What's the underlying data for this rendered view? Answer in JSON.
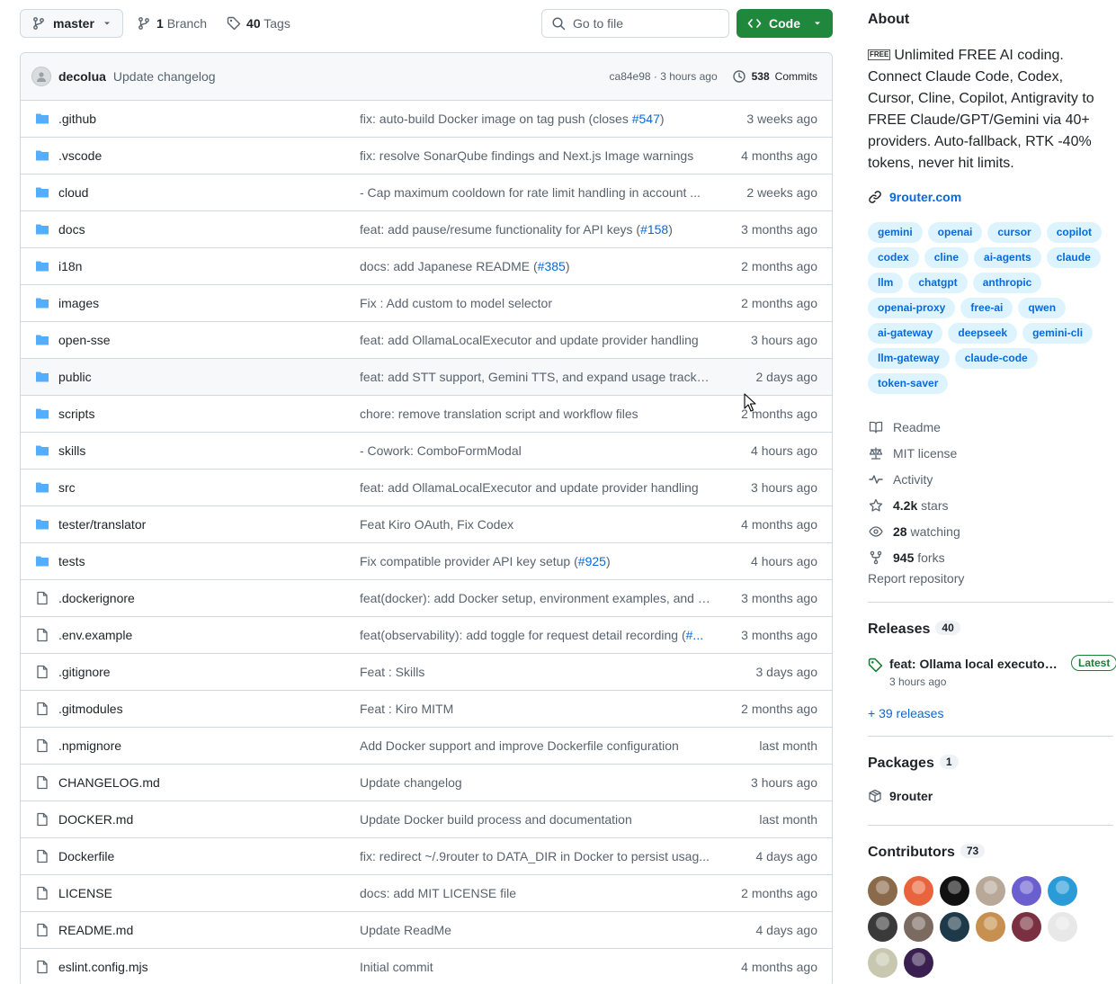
{
  "toolbar": {
    "branch_name": "master",
    "branch_count": "1",
    "branch_label": "Branch",
    "tag_count": "40",
    "tag_label": "Tags",
    "goto_placeholder": "Go to file",
    "code_label": "Code"
  },
  "latest_commit": {
    "author": "decolua",
    "message": "Update changelog",
    "meta": "ca84e98 · 3 hours ago",
    "count": "538",
    "count_label": "Commits"
  },
  "files": [
    {
      "type": "dir",
      "name": ".github",
      "message": "fix: auto-build Docker image on tag push (closes ",
      "issue": "#547",
      "tail": ")",
      "age": "3 weeks ago"
    },
    {
      "type": "dir",
      "name": ".vscode",
      "message": "fix: resolve SonarQube findings and Next.js Image warnings",
      "issue": "",
      "tail": "",
      "age": "4 months ago"
    },
    {
      "type": "dir",
      "name": "cloud",
      "message": "- Cap maximum cooldown for rate limit handling in account ...",
      "issue": "",
      "tail": "",
      "age": "2 weeks ago"
    },
    {
      "type": "dir",
      "name": "docs",
      "message": "feat: add pause/resume functionality for API keys (",
      "issue": "#158",
      "tail": ")",
      "age": "3 months ago"
    },
    {
      "type": "dir",
      "name": "i18n",
      "message": "docs: add Japanese README (",
      "issue": "#385",
      "tail": ")",
      "age": "2 months ago"
    },
    {
      "type": "dir",
      "name": "images",
      "message": "Fix : Add custom to model selector",
      "issue": "",
      "tail": "",
      "age": "2 months ago"
    },
    {
      "type": "dir",
      "name": "open-sse",
      "message": "feat: add OllamaLocalExecutor and update provider handling",
      "issue": "",
      "tail": "",
      "age": "3 hours ago"
    },
    {
      "type": "dir",
      "name": "public",
      "message": "feat: add STT support, Gemini TTS, and expand usage tracking",
      "issue": "",
      "tail": "",
      "age": "2 days ago"
    },
    {
      "type": "dir",
      "name": "scripts",
      "message": "chore: remove translation script and workflow files",
      "issue": "",
      "tail": "",
      "age": "2 months ago"
    },
    {
      "type": "dir",
      "name": "skills",
      "message": "- Cowork: ComboFormModal",
      "issue": "",
      "tail": "",
      "age": "4 hours ago"
    },
    {
      "type": "dir",
      "name": "src",
      "message": "feat: add OllamaLocalExecutor and update provider handling",
      "issue": "",
      "tail": "",
      "age": "3 hours ago"
    },
    {
      "type": "dir",
      "name": "tester/translator",
      "message": "Feat Kiro OAuth, Fix Codex",
      "issue": "",
      "tail": "",
      "age": "4 months ago"
    },
    {
      "type": "dir",
      "name": "tests",
      "message": "Fix compatible provider API key setup (",
      "issue": "#925",
      "tail": ")",
      "age": "4 hours ago"
    },
    {
      "type": "file",
      "name": ".dockerignore",
      "message": "feat(docker): add Docker setup, environment examples, and a...",
      "issue": "",
      "tail": "",
      "age": "3 months ago"
    },
    {
      "type": "file",
      "name": ".env.example",
      "message": "feat(observability): add toggle for request detail recording (",
      "issue": "#...",
      "tail": "",
      "age": "3 months ago"
    },
    {
      "type": "file",
      "name": ".gitignore",
      "message": "Feat : Skills",
      "issue": "",
      "tail": "",
      "age": "3 days ago"
    },
    {
      "type": "file",
      "name": ".gitmodules",
      "message": "Feat : Kiro MITM",
      "issue": "",
      "tail": "",
      "age": "2 months ago"
    },
    {
      "type": "file",
      "name": ".npmignore",
      "message": "Add Docker support and improve Dockerfile configuration",
      "issue": "",
      "tail": "",
      "age": "last month"
    },
    {
      "type": "file",
      "name": "CHANGELOG.md",
      "message": "Update changelog",
      "issue": "",
      "tail": "",
      "age": "3 hours ago"
    },
    {
      "type": "file",
      "name": "DOCKER.md",
      "message": "Update Docker build process and documentation",
      "issue": "",
      "tail": "",
      "age": "last month"
    },
    {
      "type": "file",
      "name": "Dockerfile",
      "message": "fix: redirect ~/.9router to DATA_DIR in Docker to persist usag...",
      "issue": "",
      "tail": "",
      "age": "4 days ago"
    },
    {
      "type": "file",
      "name": "LICENSE",
      "message": "docs: add MIT LICENSE file",
      "issue": "",
      "tail": "",
      "age": "2 months ago"
    },
    {
      "type": "file",
      "name": "README.md",
      "message": "Update ReadMe",
      "issue": "",
      "tail": "",
      "age": "4 days ago"
    },
    {
      "type": "file",
      "name": "eslint.config.mjs",
      "message": "Initial commit",
      "issue": "",
      "tail": "",
      "age": "4 months ago"
    }
  ],
  "about": {
    "title": "About",
    "badge": "FREE",
    "description": "Unlimited FREE AI coding. Connect Claude Code, Codex, Cursor, Cline, Copilot, Antigravity to FREE Claude/GPT/Gemini via 40+ providers. Auto-fallback, RTK -40% tokens, never hit limits.",
    "homepage": "9router.com",
    "topics": [
      "gemini",
      "openai",
      "cursor",
      "copilot",
      "codex",
      "cline",
      "ai-agents",
      "claude",
      "llm",
      "chatgpt",
      "anthropic",
      "openai-proxy",
      "free-ai",
      "qwen",
      "ai-gateway",
      "deepseek",
      "gemini-cli",
      "llm-gateway",
      "claude-code",
      "token-saver"
    ],
    "readme": "Readme",
    "license": "MIT license",
    "activity": "Activity",
    "stars_count": "4.2k",
    "stars_label": "stars",
    "watching_count": "28",
    "watching_label": "watching",
    "forks_count": "945",
    "forks_label": "forks",
    "report": "Report repository"
  },
  "releases": {
    "title": "Releases",
    "count": "40",
    "latest_name": "feat: Ollama local executor, ...",
    "latest_badge": "Latest",
    "latest_time": "3 hours ago",
    "more": "+ 39 releases"
  },
  "packages": {
    "title": "Packages",
    "count": "1",
    "item": "9router"
  },
  "contributors": {
    "title": "Contributors",
    "count": "73",
    "avatar_colors": [
      "#8a6a4a",
      "#e8643c",
      "#111111",
      "#b8a898",
      "#6b5fd0",
      "#2b9bd8",
      "#3a3a3a",
      "#7a6a60",
      "#1e3a4a",
      "#c89050",
      "#7a3040",
      "#e8e8e8",
      "#c8c8b0",
      "#3a2050"
    ]
  },
  "colors": {
    "accent": "#0969da",
    "primary_button": "#1f883d",
    "folder": "#54aeff",
    "muted": "#59636e",
    "border": "#d1d9e0"
  }
}
